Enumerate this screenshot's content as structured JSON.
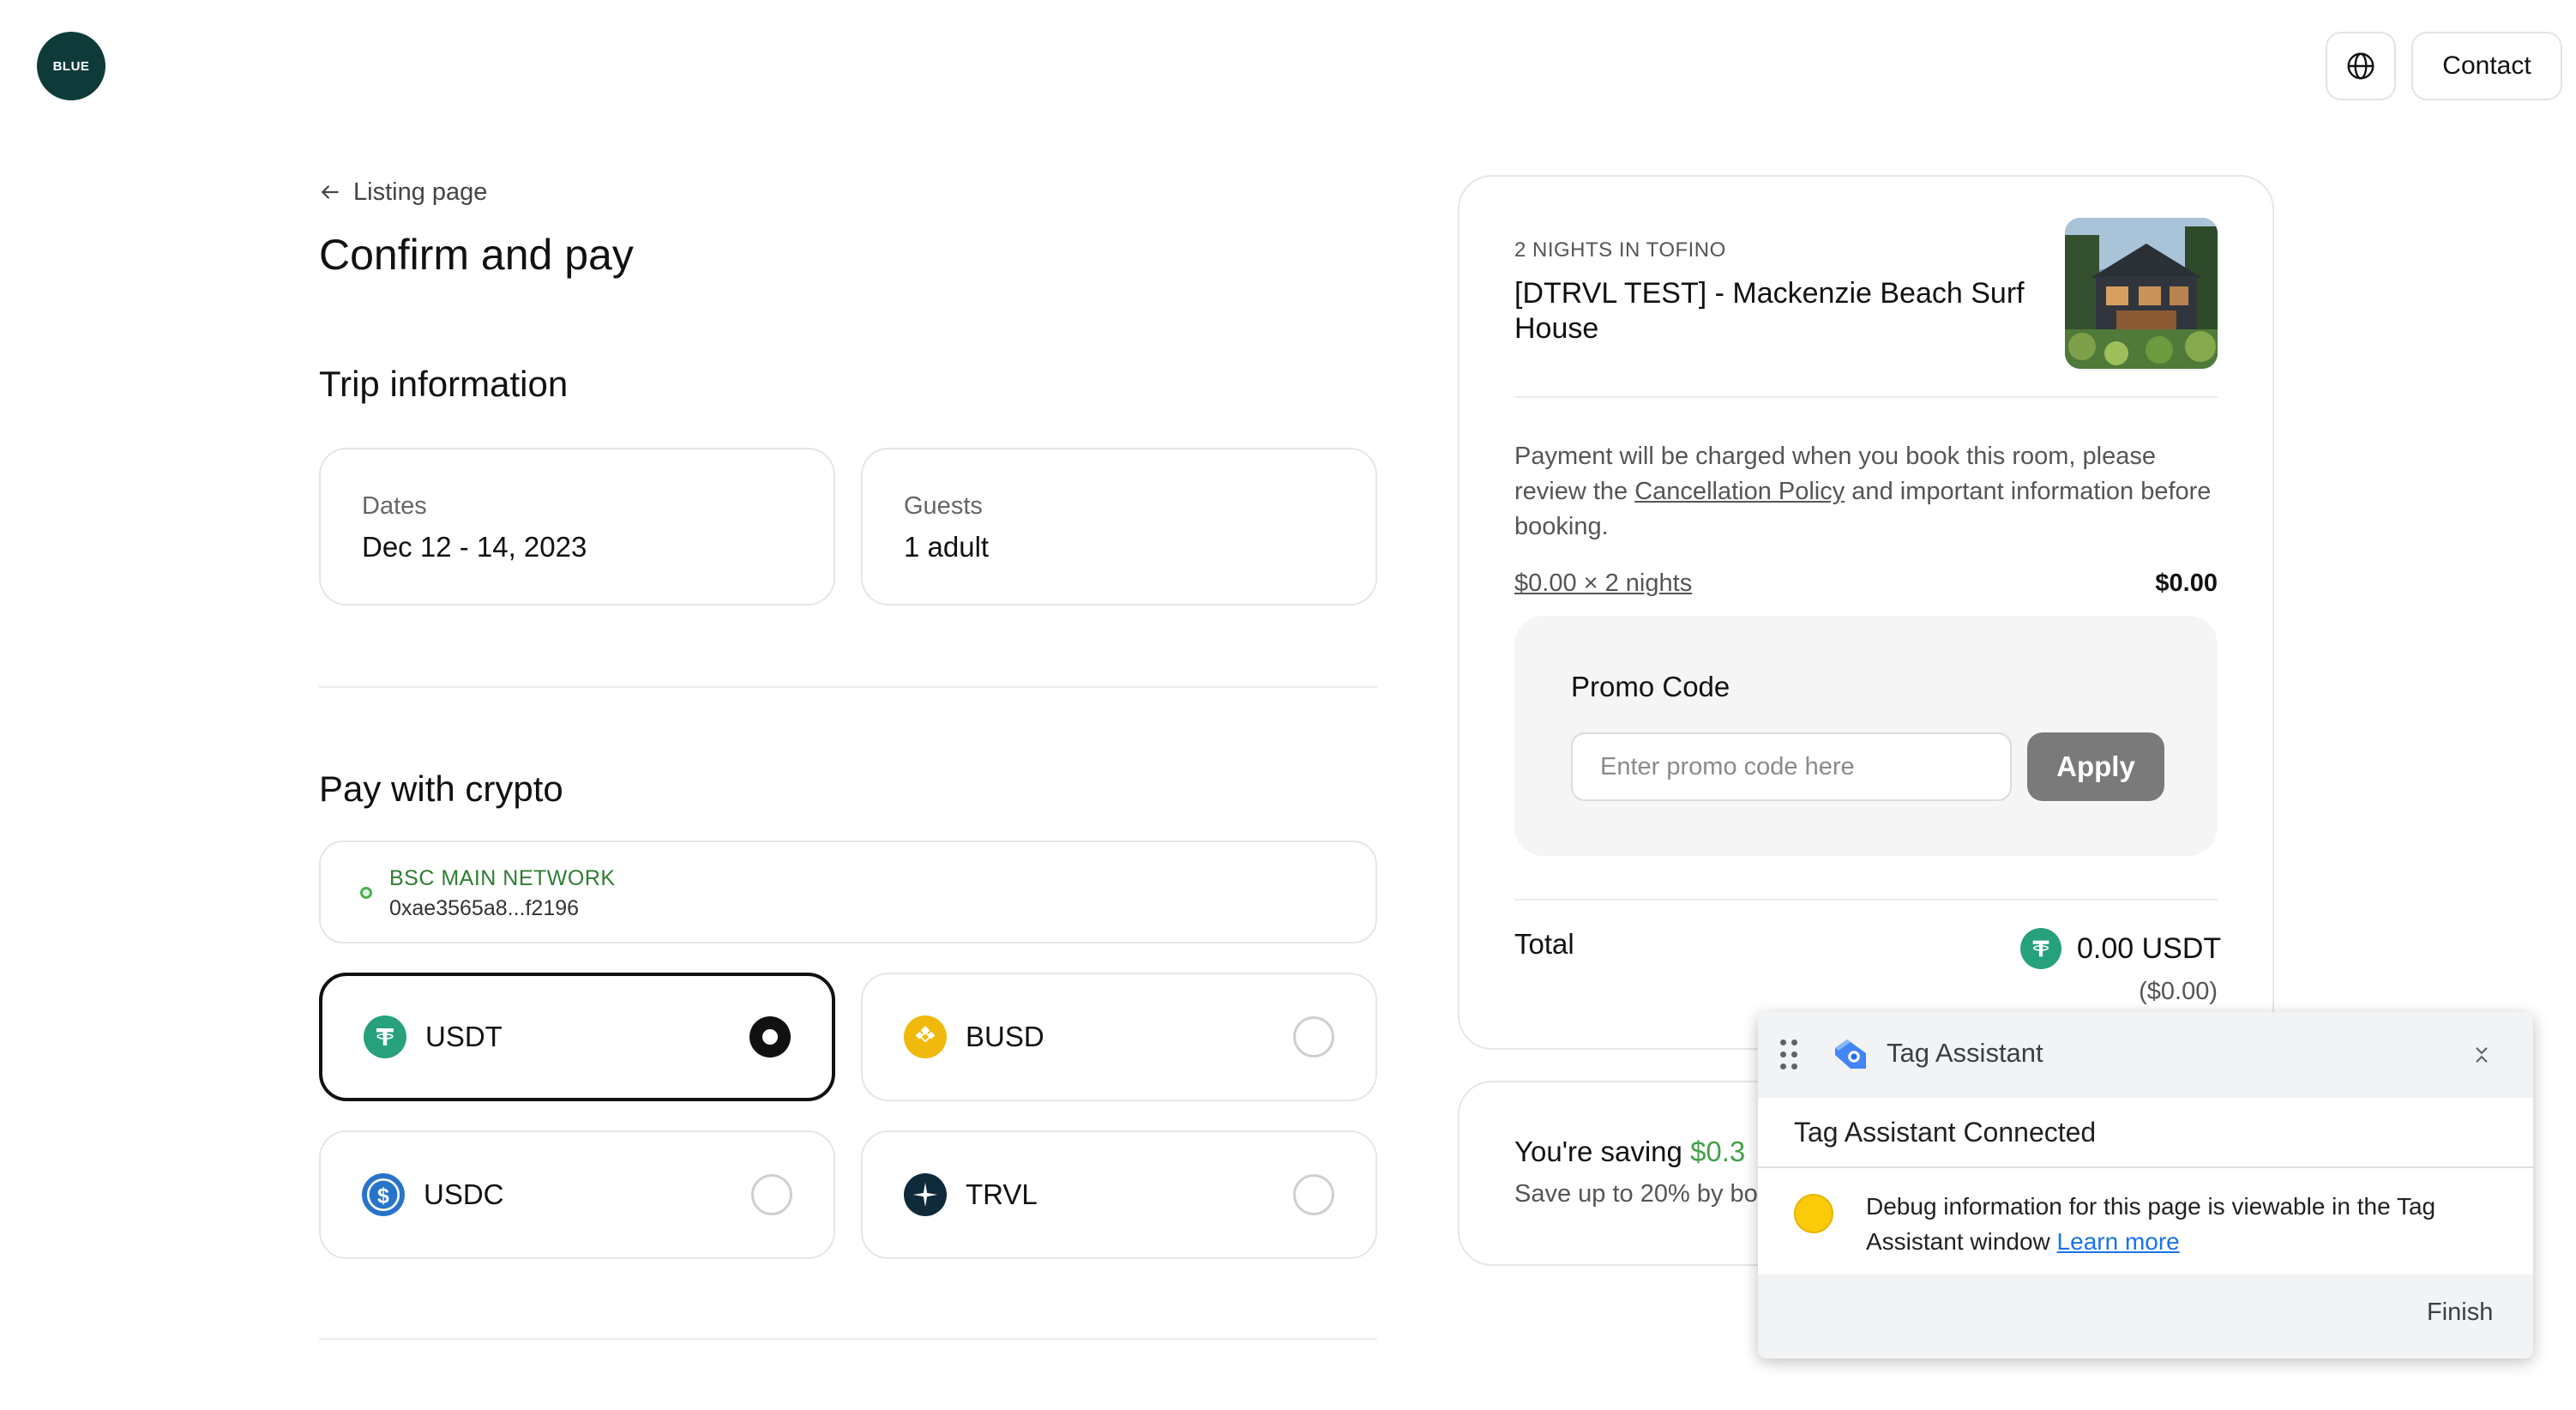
{
  "header": {
    "logo_text": "BLUE",
    "contact_label": "Contact",
    "globe_icon": "globe-icon"
  },
  "left": {
    "back_label": "Listing page",
    "page_title": "Confirm and pay",
    "trip_title": "Trip information",
    "dates_label": "Dates",
    "dates_value": "Dec 12 - 14, 2023",
    "guests_label": "Guests",
    "guests_value": "1 adult",
    "crypto_title": "Pay with crypto",
    "network_name": "BSC MAIN NETWORK",
    "network_address": "0xae3565a8...f2196",
    "coins": [
      {
        "label": "USDT",
        "selected": true,
        "color": "#26a17b"
      },
      {
        "label": "BUSD",
        "selected": false,
        "color": "#f0b90b"
      },
      {
        "label": "USDC",
        "selected": false,
        "color": "#2775ca"
      },
      {
        "label": "TRVL",
        "selected": false,
        "color": "#0f2a3a"
      }
    ]
  },
  "summary": {
    "nights_label": "2 NIGHTS IN TOFINO",
    "listing_title": "[DTRVL TEST] - Mackenzie Beach Surf House",
    "note_before": "Payment will be charged when you book this room, please review the ",
    "note_link": "Cancellation Policy",
    "note_after": " and important information before booking.",
    "price_line": "$0.00 × 2 nights",
    "price_value": "$0.00",
    "promo_title": "Promo Code",
    "promo_placeholder": "Enter promo code here",
    "apply_label": "Apply",
    "total_label": "Total",
    "total_amount": "0.00 USDT",
    "total_usd": "($0.00)",
    "saving_prefix": "You're saving ",
    "saving_value": "$0.3",
    "saving_sub": "Save up to 20% by bo"
  },
  "tag_assistant": {
    "title": "Tag Assistant",
    "connected": "Tag Assistant Connected",
    "message": "Debug information for this page is viewable in the Tag Assistant window ",
    "learn_more": "Learn more",
    "finish_label": "Finish"
  },
  "colors": {
    "logo_bg": "#0f3a3a",
    "network_green": "#2e7d32",
    "saving_green": "#43a047",
    "apply_bg": "#7a7a7a",
    "link_blue": "#1a73e8"
  }
}
